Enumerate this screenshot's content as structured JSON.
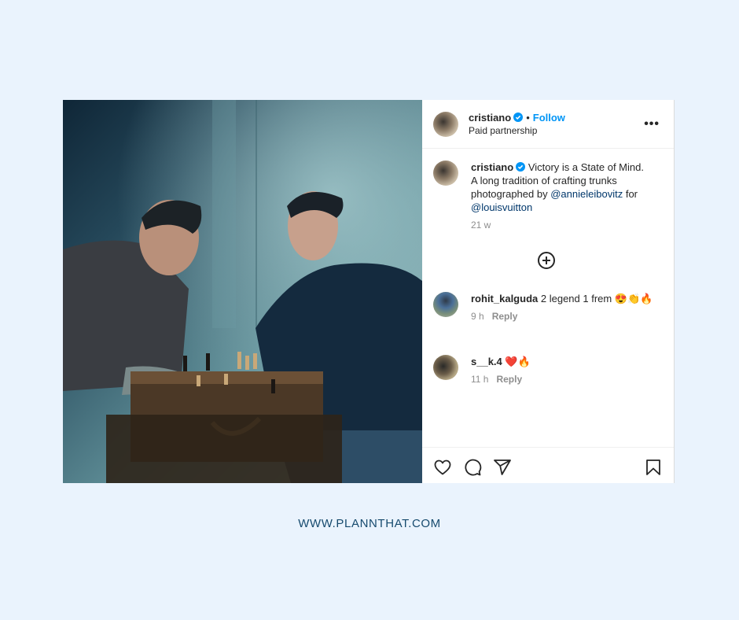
{
  "post": {
    "image_alt": "Two men playing chess on a Louis Vuitton trunk",
    "header": {
      "username": "cristiano",
      "verified": true,
      "separator": "•",
      "follow_label": "Follow",
      "subtitle": "Paid partnership",
      "more_label": "•••"
    },
    "caption": {
      "username": "cristiano",
      "text": "Victory is a State of Mind. A long tradition of crafting trunks photographed by",
      "mention1": "@annieleibovitz",
      "connector": "for",
      "mention2": "@louisvuitton",
      "time": "21 w"
    },
    "load_more_icon": "plus-circle-icon",
    "comments": [
      {
        "username": "rohit_kalguda",
        "text": "2 legend 1 frem 😍👏🔥",
        "time": "9 h",
        "reply_label": "Reply"
      },
      {
        "username": "s__k.4",
        "text": "❤️🔥",
        "time": "11 h",
        "reply_label": "Reply"
      }
    ],
    "actions": [
      "heart-icon",
      "comment-icon",
      "share-icon",
      "bookmark-icon"
    ]
  },
  "colors": {
    "background": "#eaf3fd",
    "follow": "#0095f6",
    "mention": "#00376b",
    "footer": "#164a6e"
  },
  "footer": {
    "url_text": "WWW.PLANNTHAT.COM"
  }
}
